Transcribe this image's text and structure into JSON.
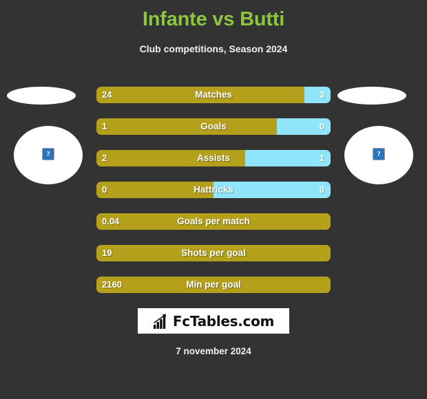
{
  "header": {
    "title": "Infante vs Butti",
    "subtitle": "Club competitions, Season 2024",
    "title_color": "#8cc63e",
    "subtitle_color": "#f2f2f2"
  },
  "players": {
    "left": {
      "photo_placeholder": "broken-image-icon",
      "placeholder_glyph": "?"
    },
    "right": {
      "photo_placeholder": "broken-image-icon",
      "placeholder_glyph": "?"
    }
  },
  "colors": {
    "background": "#333333",
    "left_bar": "#b5a01b",
    "right_bar": "#91e5fa",
    "accent_green": "#8cc63e",
    "logo_background": "#ffffff"
  },
  "footer": {
    "logo_text": "FcTables.com",
    "logo_icon": "bar-chart-arrow-icon",
    "date": "7 november 2024"
  },
  "chart_data": {
    "type": "bar",
    "title": "Infante vs Butti",
    "subtitle": "Club competitions, Season 2024",
    "orientation": "horizontal-diverging",
    "series": [
      {
        "name": "Infante",
        "color": "#b5a01b",
        "values": [
          24,
          1,
          2,
          0,
          0.04,
          19,
          2160
        ]
      },
      {
        "name": "Butti",
        "color": "#91e5fa",
        "values": [
          3,
          0,
          1,
          0,
          null,
          null,
          null
        ]
      }
    ],
    "categories": [
      "Matches",
      "Goals",
      "Assists",
      "Hattricks",
      "Goals per match",
      "Shots per goal",
      "Min per goal"
    ],
    "rows": [
      {
        "label": "Matches",
        "left_value": "24",
        "right_value": "3",
        "left_pct": 88.9,
        "has_right": true
      },
      {
        "label": "Goals",
        "left_value": "1",
        "right_value": "0",
        "left_pct": 77.0,
        "has_right": true
      },
      {
        "label": "Assists",
        "left_value": "2",
        "right_value": "1",
        "left_pct": 63.4,
        "has_right": true
      },
      {
        "label": "Hattricks",
        "left_value": "0",
        "right_value": "0",
        "left_pct": 50.0,
        "has_right": true
      },
      {
        "label": "Goals per match",
        "left_value": "0.04",
        "right_value": "",
        "left_pct": 100,
        "has_right": false
      },
      {
        "label": "Shots per goal",
        "left_value": "19",
        "right_value": "",
        "left_pct": 100,
        "has_right": false
      },
      {
        "label": "Min per goal",
        "left_value": "2160",
        "right_value": "",
        "left_pct": 100,
        "has_right": false
      }
    ],
    "xlabel": "",
    "ylabel": "",
    "grid": false,
    "legend": "none"
  }
}
